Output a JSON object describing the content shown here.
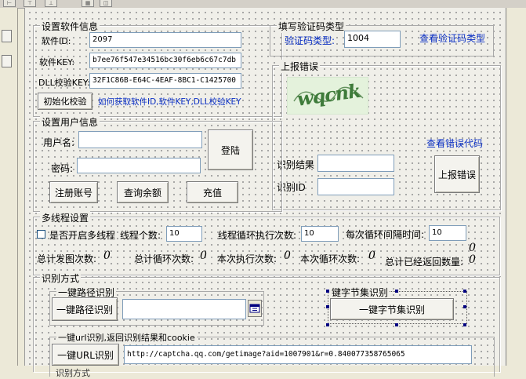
{
  "software_info": {
    "title": "设置软件信息",
    "id_label": "软件ID:",
    "id_value": "2097",
    "key_label": "软件KEY:",
    "key_value": "b7ee76f547e34516bc30f6eb6c67c7db",
    "dll_label": "DLL校验KEY:",
    "dll_value": "32F1C86B-E64C-4EAF-8BC1-C1425700",
    "init_button": "初始化校验",
    "help_link": "如何获取软件ID,软件KEY,DLL校验KEY"
  },
  "captcha_type": {
    "title": "填写验证码类型",
    "label": "验证码类型:",
    "value": "1004",
    "link": "查看验证码类型"
  },
  "report_error": {
    "title": "上报错误",
    "captcha_image_text": "wqcnk",
    "view_code_link": "查看错误代码",
    "result_label": "识别结果",
    "result_value": "",
    "id_label": "识别ID",
    "id_value": "",
    "report_button": "上报错误"
  },
  "user_info": {
    "title": "设置用户信息",
    "username_label": "用户名:",
    "username_value": "",
    "password_label": "密码:",
    "password_value": "",
    "login_button": "登陆",
    "register_button": "注册账号",
    "balance_button": "查询余额",
    "recharge_button": "充值"
  },
  "multithread": {
    "title": "多线程设置",
    "enable_label": "是否开启多线程",
    "thread_count_label": "线程个数:",
    "thread_count_value": "10",
    "loop_count_label": "线程循环执行次数:",
    "loop_count_value": "10",
    "interval_label": "每次循环间隔时间:",
    "interval_value": "10",
    "total_sent_label": "总计发图次数:",
    "total_sent_value": "0",
    "total_loops_label": "总计循环次数:",
    "total_loops_value": "0",
    "this_exec_label": "本次执行次数:",
    "this_exec_value": "0",
    "this_loops_label": "本次循环次数:",
    "this_loops_value": "0",
    "total_returned_label": "总计已经返回数量:",
    "total_returned_value": "0",
    "total_returned_extra": "0"
  },
  "recognition": {
    "title": "识别方式",
    "path_group_title": "一键路径识别",
    "path_button": "一键路径识别",
    "path_value": "",
    "bytes_group_title": "键字节集识别",
    "bytes_button": "一键字节集识别",
    "url_group_title": "一键url识别,返回识别结果和cookie",
    "url_button": "一键URL识别",
    "url_value": "http://captcha.qq.com/getimage?aid=1007901&r=0.840077358765065",
    "bottom_partial": "识别方式"
  },
  "toolbar_icons": [
    "align-left-icon",
    "align-center-icon",
    "align-bottom-icon",
    "align-grid-icon",
    "resize-icon"
  ]
}
